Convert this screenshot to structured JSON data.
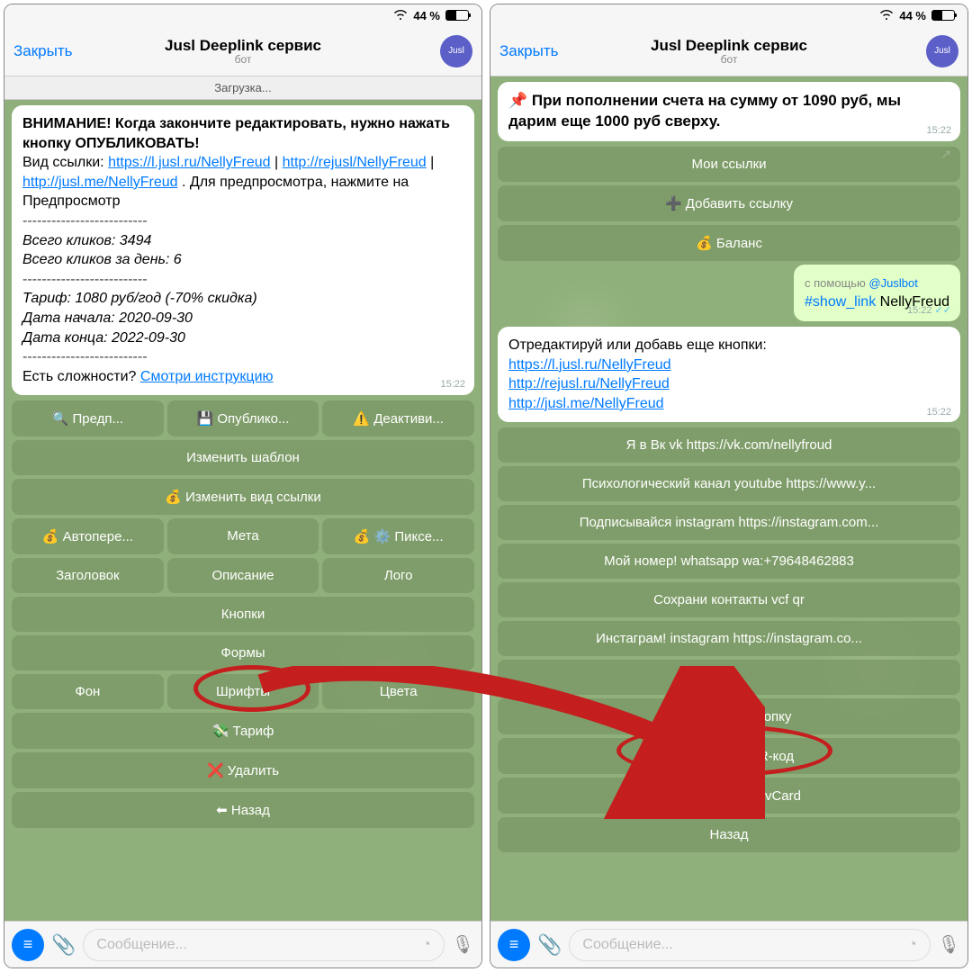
{
  "status": {
    "battery": "44 %"
  },
  "header": {
    "close": "Закрыть",
    "title": "Jusl Deeplink сервис",
    "sub": "бот",
    "avatar": "Jusl"
  },
  "loading": "Загрузка...",
  "left": {
    "msg": {
      "l1": "ВНИМАНИЕ! Когда закончите редактировать, нужно нажать кнопку ОПУБЛИКОВАТЬ!",
      "l2a": "Вид ссылки: ",
      "u1": "https://l.jusl.ru/NellyFreud",
      "u2": "http://rejusl/NellyFreud",
      "u3": "http://jusl.me/NellyFreud",
      "l2b": " . Для предпросмотра, нажмите на Предпросмотр",
      "c1": "Всего кликов: 3494",
      "c2": "Всего кликов за день: 6",
      "t1": "Тариф: 1080 руб/год (-70% скидка)",
      "t2": "Дата начала: 2020-09-30",
      "t3": "Дата конца: 2022-09-30",
      "help": "Есть сложности? ",
      "helpLink": "Смотри инструкцию",
      "time": "15:22"
    },
    "kb": {
      "r1": [
        "🔍 Предп...",
        "💾 Опублико...",
        "⚠️ Деактиви..."
      ],
      "r2": "Изменить шаблон",
      "r3": "💰 Изменить вид ссылки",
      "r4": [
        "💰 Автопере...",
        "Мета",
        "💰 ⚙️ Пиксе..."
      ],
      "r5": [
        "Заголовок",
        "Описание",
        "Лого"
      ],
      "r6": "Кнопки",
      "r7": "Формы",
      "r8": [
        "Фон",
        "Шрифты",
        "Цвета"
      ],
      "r9": "💸 Тариф",
      "r10": "❌ Удалить",
      "r11": "⬅ Назад"
    }
  },
  "right": {
    "msg1": {
      "pin": "📌 При пополнении счета на сумму от 1090 руб, мы дарим еще 1000 руб сверху.",
      "time": "15:22"
    },
    "top": {
      "b1": "Мои ссылки",
      "b2": "➕ Добавить ссылку",
      "b3": "💰 Баланс"
    },
    "out": {
      "via": "с помощью ",
      "bot": "@Juslbot",
      "cmd": "#show_link",
      "name": " NellyFreud",
      "time": "15:22"
    },
    "msg2": {
      "t": "Отредактируй или добавь еще кнопки:",
      "u1": "https://l.jusl.ru/NellyFreud",
      "u2": "http://rejusl.ru/NellyFreud",
      "u3": "http://jusl.me/NellyFreud",
      "time": "15:22"
    },
    "kb": [
      "Я в Вк vk https://vk.com/nellyfroud",
      "Психологический канал youtube https://www.y...",
      "Подписывайся instagram https://instagram.com...",
      "Мой номер! whatsapp wa:+79648462883",
      "Сохрани контакты vcf qr",
      "Инстаграм! instagram https://instagram.co...",
      ">>",
      "➕ Добавить кнопку",
      "➕ Добавить QR-код",
      "➕ Добавить QR vCard",
      "Назад"
    ]
  },
  "footer": {
    "ph": "Сообщение..."
  }
}
